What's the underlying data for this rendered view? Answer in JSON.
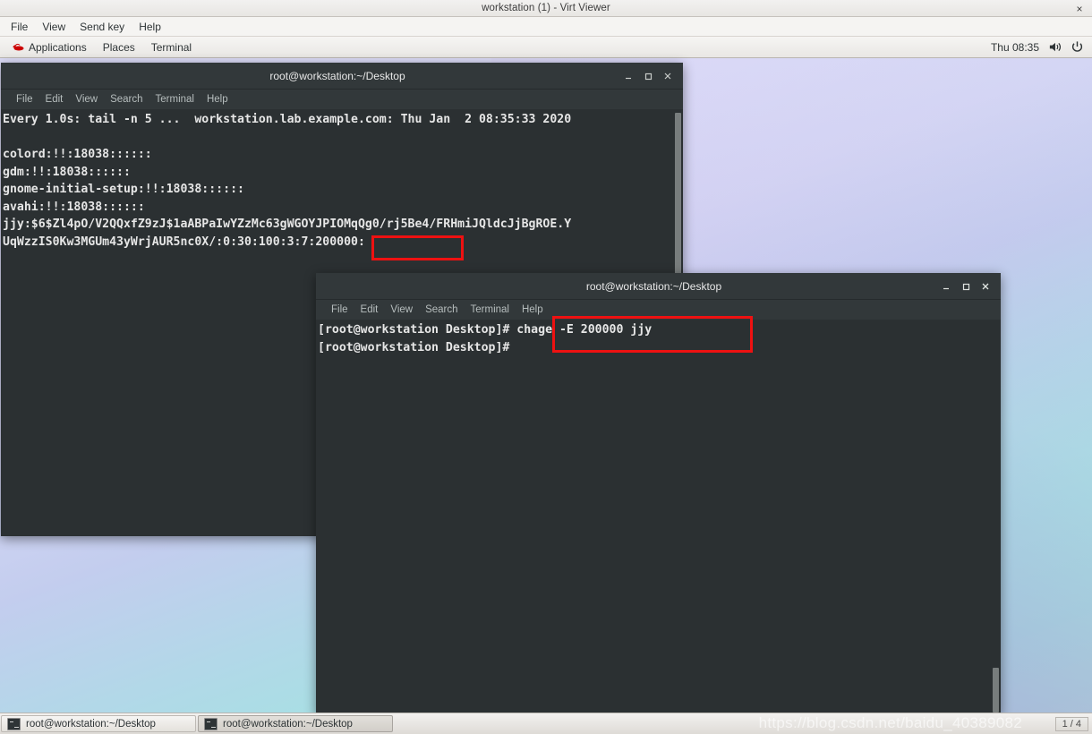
{
  "virt_viewer": {
    "title": "workstation (1) - Virt Viewer",
    "close_label": "×",
    "menus": [
      "File",
      "View",
      "Send key",
      "Help"
    ]
  },
  "gnome_panel": {
    "logo_name": "red-hat-logo",
    "items": [
      "Applications",
      "Places",
      "Terminal"
    ],
    "clock": "Thu 08:35",
    "volume_icon": "volume-icon",
    "power_icon": "power-icon"
  },
  "terminal_1": {
    "title": "root@workstation:~/Desktop",
    "menus": [
      "File",
      "Edit",
      "View",
      "Search",
      "Terminal",
      "Help"
    ],
    "minimize_label": "–",
    "maximize_label": "□",
    "close_label": "×",
    "lines": [
      "Every 1.0s: tail -n 5 ...  workstation.lab.example.com: Thu Jan  2 08:35:33 2020",
      "",
      "colord:!!:18038::::::",
      "gdm:!!:18038::::::",
      "gnome-initial-setup:!!:18038::::::",
      "avahi:!!:18038::::::",
      "jjy:$6$Zl4pO/V2QQxfZ9zJ$1aABPaIwYZzMc63gWGOYJPIOMqQg0/rj5Be4/FRHmiJQldcJjBgROE.Y",
      "UqWzzIS0Kw3MGUm43yWrjAUR5nc0X/:0:30:100:3:7:200000:"
    ],
    "highlighted_value": "200000:"
  },
  "terminal_2": {
    "title": "root@workstation:~/Desktop",
    "menus": [
      "File",
      "Edit",
      "View",
      "Search",
      "Terminal",
      "Help"
    ],
    "minimize_label": "–",
    "maximize_label": "□",
    "close_label": "×",
    "lines": [
      "[root@workstation Desktop]# chage -E 200000 jjy",
      "[root@workstation Desktop]# "
    ],
    "highlighted_command": "chage -E 200000 jjy"
  },
  "taskbar": {
    "tasks": [
      {
        "label": "root@workstation:~/Desktop",
        "icon": "terminal-icon",
        "active": false
      },
      {
        "label": "root@workstation:~/Desktop",
        "icon": "terminal-icon",
        "active": true
      }
    ],
    "workspace": "1 / 4"
  },
  "watermark": "https://blog.csdn.net/baidu_40389082",
  "colors": {
    "annotation": "#ee1111",
    "terminal_bg": "#2b3032",
    "titlebar_bg": "#32383a",
    "panel_bg": "#f2f1f0"
  }
}
